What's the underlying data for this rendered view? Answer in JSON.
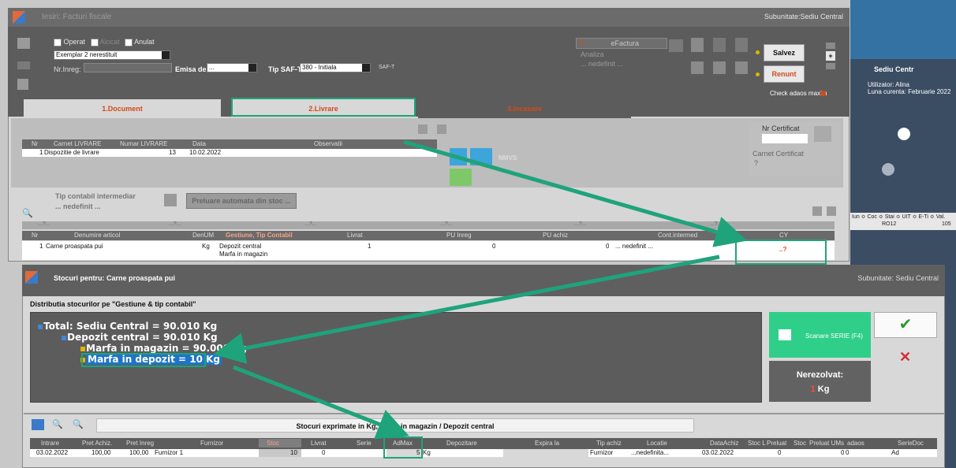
{
  "window": {
    "title": "Iesiri: Facturi fiscale",
    "subunitate": "Subunitate:Sediu Central"
  },
  "right_panel": {
    "location": "Sediu Centr",
    "user": "Utilizator: Alina",
    "month": "Luna curenta: Februarie 2022",
    "cols": "Iun ≎ Coc ≎ Stai ≎ UIT ≎ E-Ti ≎ Val.",
    "country": "RO12",
    "val": "105"
  },
  "header": {
    "operat": "Operat",
    "alocat": "Alocat",
    "anulat": "Anulat",
    "exemplar": "Exemplar 2 nerestituit",
    "nr_inreg_label": "Nr.Inreg:",
    "emisa_label": "Emisa de",
    "emisa_value": "...",
    "tip_saft_label": "Tip SAF-T",
    "tip_saft_value": "380 - Initiala",
    "saft_badge": "SAF-T",
    "efactura": "eFactura",
    "analiza": "Analiza",
    "nedefinit": "... nedefinit ...",
    "salvez": "Salvez",
    "renunt": "Renunt",
    "check_adaos": "Check adaos maxim",
    "plus": "+"
  },
  "tabs": [
    {
      "label": "1.Document"
    },
    {
      "label": "2.Livrare"
    },
    {
      "label": "3.Incasare"
    }
  ],
  "livrare_grid": {
    "headers": [
      "Nr",
      "Carnet LIVRARE",
      "Numar LIVRARE",
      "Data",
      "Observatii"
    ],
    "row": {
      "nr": "1",
      "carnet": "Dispozitie de livrare",
      "numar": "13",
      "data": "10.02.2022",
      "obs": ""
    }
  },
  "certificat": {
    "nr_label": "Nr Certificat",
    "carnet_label": "Carnet Certificat",
    "q": "?",
    "nmvs": "NMVS"
  },
  "tip_contabil": {
    "label": "Tip contabil intermediar",
    "value": "... nedefinit ...",
    "preluare": "Preluare automata din stoc ..."
  },
  "filter_row": [
    "...?...",
    "...?...",
    "...?...",
    "...?...",
    "...?...",
    "...?..."
  ],
  "articles_grid": {
    "headers": [
      "Nr",
      "Denumire articol",
      "DenUM",
      "Gestiune, Tip Contabil",
      "Livrat",
      "PU Inreg",
      "PU achiz",
      "Cont.intermed",
      "CY"
    ],
    "row": {
      "nr": "1",
      "denumire": "Carne proaspata pui",
      "um": "Kg",
      "gestiune": "Depozit central",
      "tip": "Marfa in magazin",
      "livrat": "1",
      "pu_inreg": "0",
      "pu_achiz": "0",
      "cont": "... nedefinit ...",
      "cy": "..?"
    }
  },
  "popup": {
    "title": "Stocuri pentru: Carne proaspata pui",
    "subunitate": "Subunitate: Sediu Central",
    "distributie": "Distributia stocurilor pe \"Gestiune & tip contabil\"",
    "tree": [
      "Total: Sediu Central = 90.010 Kg",
      "Depozit central = 90.010 Kg",
      "Marfa in magazin = 90.000 Kg",
      "Marfa in depozit = 10 Kg"
    ],
    "scanare": "Scanare SERIE (F4)",
    "nerezolvat": "Nerezolvat:",
    "nerezolvat_qty": "1",
    "nerezolvat_um": "Kg",
    "stocuri_title": "Stocuri exprimate in Kg, Marfa in magazin / Depozit central"
  },
  "bottom_grid": {
    "headers": [
      "Intrare",
      "Pret Achiz.",
      "Pret Inreg",
      "Furnizor",
      "Stoc",
      "Livrat",
      "Serie",
      "AdMax",
      "Depozitare",
      "Expira la",
      "Tip achiz",
      "Locatie",
      "DataAchiz",
      "Stoc L",
      "Preluat",
      "Stoc",
      "Preluat UMs",
      "adaos",
      "SerieDoc"
    ],
    "row": {
      "intrare": "03.02.2022",
      "pret_achiz": "100,00",
      "pret_inreg": "100,00",
      "furnizor": "Furnizor 1",
      "stoc": "10",
      "livrat": "0",
      "serie": "",
      "admax": "5",
      "admax_um": "Kg",
      "depozitare": "",
      "expira": "",
      "tip_achiz": "Furnizor",
      "locatie": "...nedefinita...",
      "data_achiz": "03.02.2022",
      "stoc_l": "0",
      "preluat_ums": "0",
      "adaos": "0",
      "seriedoc": "Ad"
    }
  },
  "colors": {
    "accent_red": "#d34a1a",
    "highlight_green": "#1fa37a",
    "tree_selected": "#1e74c8",
    "scan_green": "#2fcf8a"
  }
}
